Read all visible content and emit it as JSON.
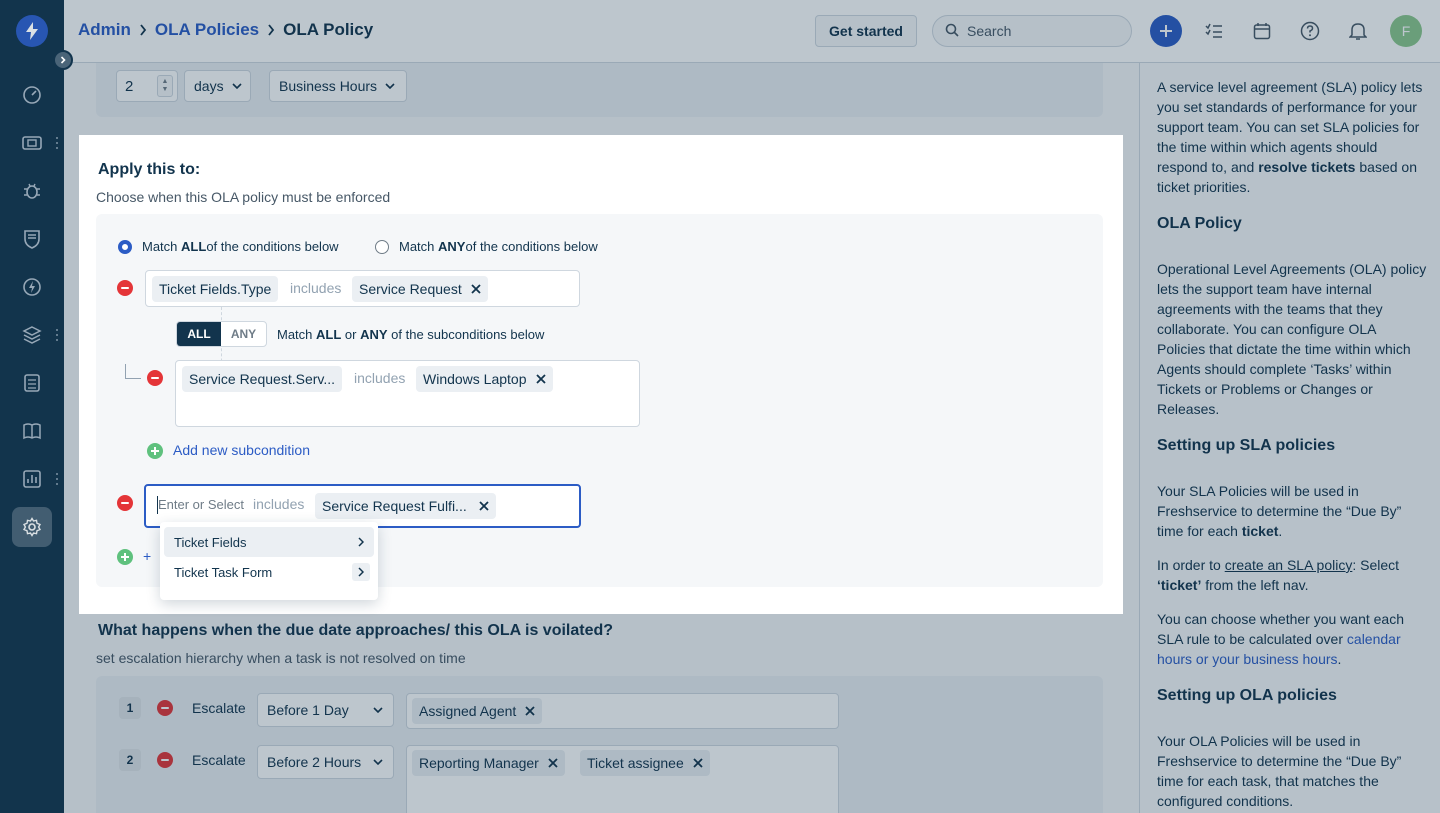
{
  "breadcrumb": {
    "admin": "Admin",
    "ola_policies": "OLA Policies",
    "current": "OLA Policy"
  },
  "header": {
    "get_started": "Get started",
    "search_placeholder": "Search",
    "avatar_initial": "F"
  },
  "top_row": {
    "number_value": "2",
    "unit": "days",
    "hours_type": "Business Hours"
  },
  "apply": {
    "title": "Apply this to:",
    "subtitle": "Choose when this OLA policy must be enforced",
    "match_all_pre": "Match ",
    "match_all_bold": "ALL",
    "match_all_post": " of the conditions below",
    "match_any_pre": "Match ",
    "match_any_bold": "ANY",
    "match_any_post": " of the conditions below",
    "condition1": {
      "field": "Ticket Fields.Type",
      "operator": "includes",
      "value": "Service Request"
    },
    "toggle_all": "ALL",
    "toggle_any": "ANY",
    "sub_text_pre": "Match ",
    "sub_text_all": "ALL",
    "sub_text_mid": " or ",
    "sub_text_any": "ANY",
    "sub_text_post": " of the subconditions below",
    "subcondition1": {
      "field": "Service Request.Serv...",
      "operator": "includes",
      "value": "Windows Laptop"
    },
    "add_subcondition": "Add new subcondition",
    "condition2": {
      "placeholder": "Enter or Select",
      "operator": "includes",
      "value": "Service Request Fulfi..."
    },
    "dropdown": [
      "Ticket Fields",
      "Ticket Task Form"
    ]
  },
  "escalation": {
    "title": "What happens when the due date approaches/ this OLA is voilated?",
    "subtitle": "set escalation hierarchy when a task is not resolved on time",
    "rows": [
      {
        "num": "1",
        "label": "Escalate",
        "when": "Before 1 Day",
        "recipients": [
          "Assigned Agent"
        ]
      },
      {
        "num": "2",
        "label": "Escalate",
        "when": "Before 2 Hours",
        "recipients": [
          "Reporting Manager",
          "Ticket assignee"
        ]
      }
    ]
  },
  "help": {
    "p1_a": "A service level agreement (SLA) policy lets you set standards of performance for your support team. You can set SLA policies for the time within which agents should respond to, and ",
    "p1_bold": "resolve tickets",
    "p1_b": " based on ticket priorities.",
    "h_ola": "OLA Policy",
    "p2": "Operational Level Agreements (OLA) policy lets the support team have internal agreements with the teams that they collaborate. You can configure OLA Policies that dictate the time within which Agents should complete ‘Tasks’ within Tickets or Problems or Changes or Releases.",
    "h_sla": "Setting up SLA policies",
    "p3_a": "Your SLA Policies will be used in Freshservice to determine the “Due By” time for each ",
    "p3_bold": "ticket",
    "p3_b": ".",
    "p4_a": "In order to ",
    "p4_link": "create an SLA policy",
    "p4_b": ": Select ",
    "p4_bold": "‘ticket’",
    "p4_c": " from the left nav.",
    "p5_a": "You can choose whether you want each SLA rule to be calculated over ",
    "p5_link": "calendar hours or your business hours",
    "p5_b": ".",
    "h_ola_setup": "Setting up OLA policies",
    "p6": "Your OLA Policies will be used in Freshservice to determine the “Due By” time for each task, that matches the configured conditions."
  },
  "colors": {
    "sidebar": "#12344d",
    "brand_blue": "#2c5cc5",
    "remove_red": "#e43538",
    "add_green": "#5fc17e"
  }
}
